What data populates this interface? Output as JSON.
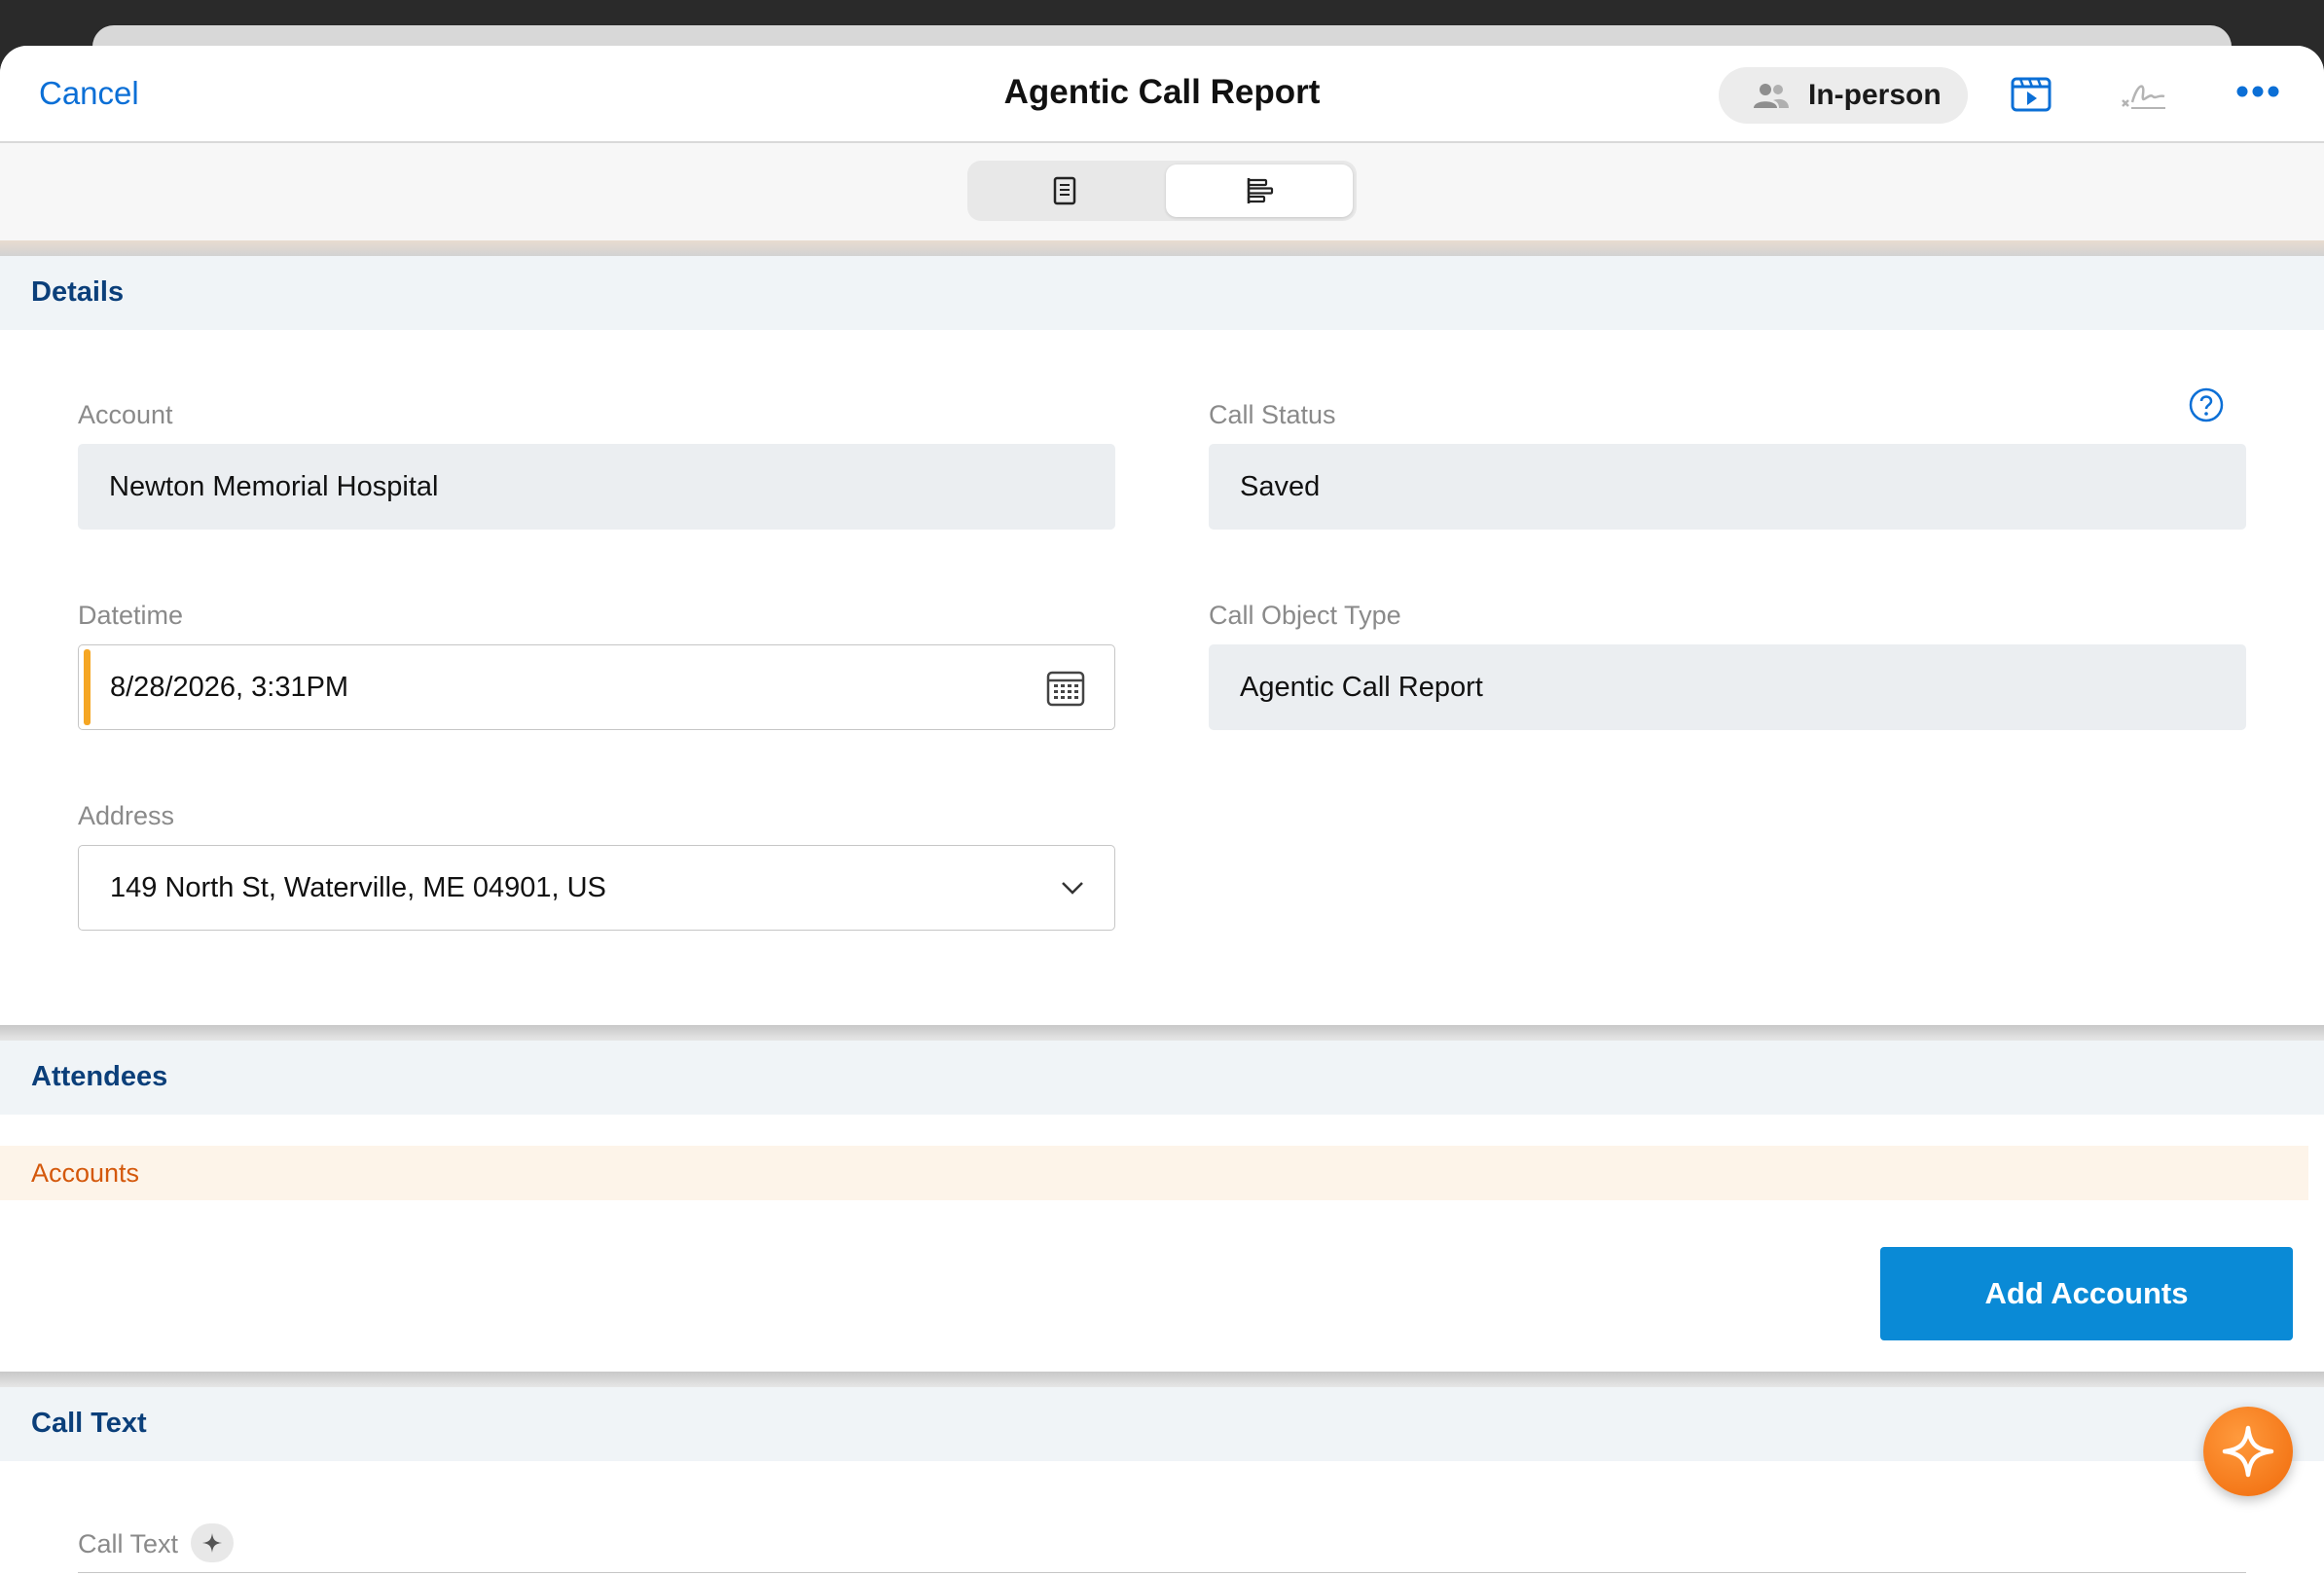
{
  "header": {
    "cancel_label": "Cancel",
    "title": "Agentic Call Report",
    "channel_label": "In-person",
    "icons": [
      "people-icon",
      "media-icon",
      "signature-icon",
      "more-icon"
    ]
  },
  "segmented": {
    "options": [
      {
        "icon": "document-icon",
        "active": false
      },
      {
        "icon": "outline-icon",
        "active": true
      }
    ]
  },
  "details": {
    "section_title": "Details",
    "account_label": "Account",
    "account_value": "Newton Memorial Hospital",
    "call_status_label": "Call Status",
    "call_status_value": "Saved",
    "datetime_label": "Datetime",
    "datetime_value": "8/28/2026, 3:31PM",
    "call_object_type_label": "Call Object Type",
    "call_object_type_value": "Agentic Call Report",
    "address_label": "Address",
    "address_value": "149 North St, Waterville, ME 04901, US"
  },
  "attendees": {
    "section_title": "Attendees",
    "accounts_label": "Accounts",
    "add_button_label": "Add Accounts"
  },
  "call_text": {
    "section_title": "Call Text",
    "field_label": "Call Text"
  },
  "colors": {
    "link_blue": "#0b6fd6",
    "section_title": "#0b3f7a",
    "primary_button": "#0a8ad6",
    "accounts_orange": "#d4580b",
    "required_accent": "#f5a623",
    "fab_orange": "#f06a0a"
  }
}
